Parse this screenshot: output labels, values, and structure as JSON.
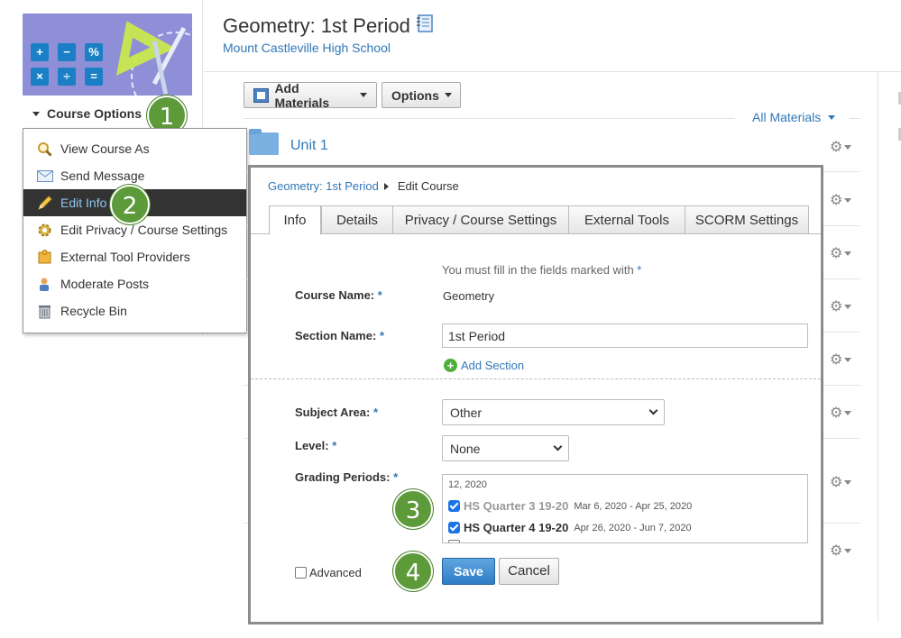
{
  "sidebar": {
    "course_options_label": "Course Options",
    "image_keys": [
      "+",
      "−",
      "%",
      "×",
      "÷",
      "="
    ],
    "menu": [
      {
        "label": "View Course As",
        "icon": "magnifier-icon"
      },
      {
        "label": "Send Message",
        "icon": "envelope-icon"
      },
      {
        "label": "Edit Info",
        "icon": "pencil-icon",
        "active": true
      },
      {
        "label": "Edit Privacy / Course Settings",
        "icon": "gear-settings-icon"
      },
      {
        "label": "External Tool Providers",
        "icon": "puzzle-icon"
      },
      {
        "label": "Moderate Posts",
        "icon": "moderator-icon"
      },
      {
        "label": "Recycle Bin",
        "icon": "recycle-bin-icon"
      }
    ]
  },
  "steps": [
    "1",
    "2",
    "3",
    "4"
  ],
  "header": {
    "title": "Geometry: 1st Period",
    "school": "Mount Castleville High School"
  },
  "toolbar": {
    "add_materials": "Add Materials",
    "options": "Options",
    "all_materials": "All Materials"
  },
  "materials": {
    "unit_title": "Unit 1"
  },
  "dialog": {
    "breadcrumb_link": "Geometry: 1st Period",
    "breadcrumb_current": "Edit Course",
    "tabs": [
      "Info",
      "Details",
      "Privacy / Course Settings",
      "External Tools",
      "SCORM Settings"
    ],
    "note_prefix": "You must fill in the fields marked with",
    "required_mark": "*",
    "labels": {
      "course_name": "Course Name:",
      "section_name": "Section Name:",
      "subject_area": "Subject Area:",
      "level": "Level:",
      "grading_periods": "Grading Periods:"
    },
    "course_name_value": "Geometry",
    "section_name_value": "1st Period",
    "add_section": "Add Section",
    "subject_area_value": "Other",
    "level_value": "None",
    "grading_periods": {
      "header": "12, 2020",
      "items": [
        {
          "name": "HS Quarter 3 19-20",
          "dates": "Mar 6, 2020 - Apr 25, 2020",
          "checked": true
        },
        {
          "name": "HS Quarter 4 19-20",
          "dates": "Apr 26, 2020 - Jun 7, 2020",
          "checked": true
        }
      ]
    },
    "advanced_label": "Advanced",
    "save": "Save",
    "cancel": "Cancel"
  },
  "colors": {
    "link": "#3178b7",
    "step_badge": "#5d9a3a",
    "save_button": "#2e7cc5",
    "menu_active_bg": "#333333"
  }
}
